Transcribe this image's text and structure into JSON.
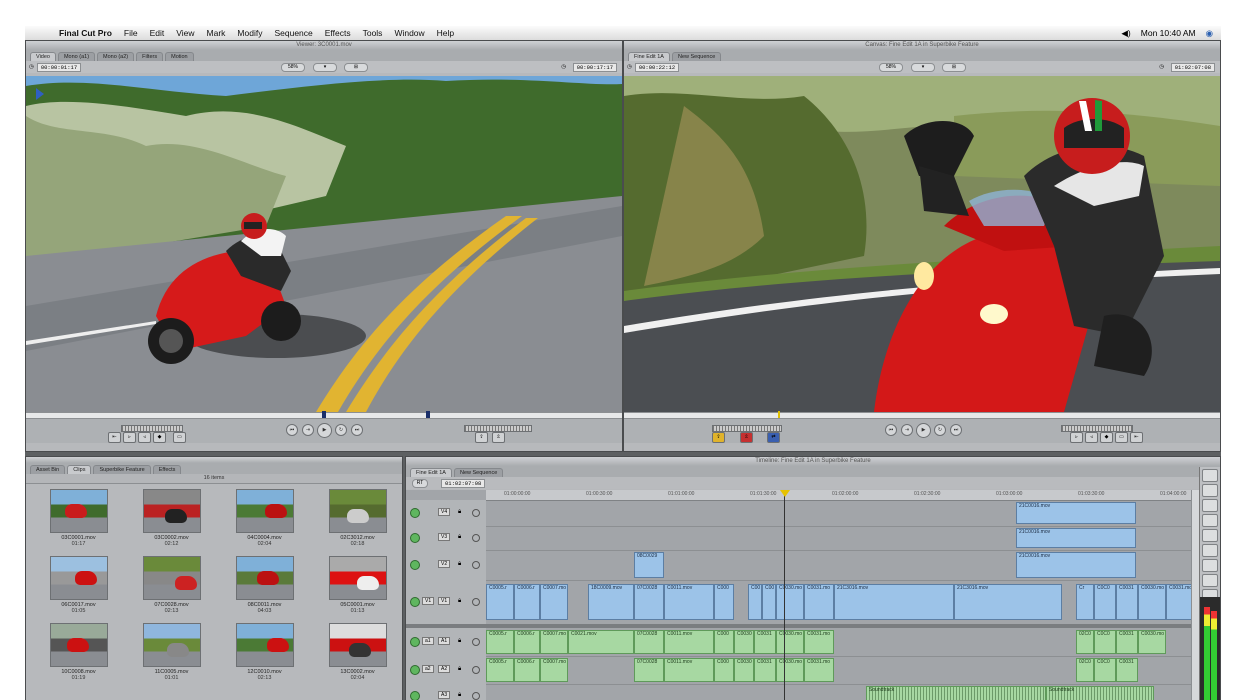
{
  "menubar": {
    "apple_glyph": "",
    "app_name": "Final Cut Pro",
    "items": [
      "File",
      "Edit",
      "View",
      "Mark",
      "Modify",
      "Sequence",
      "Effects",
      "Tools",
      "Window",
      "Help"
    ],
    "clock": "Mon 10:40 AM",
    "volume_glyph": "◀)",
    "spotlight_glyph": "◉"
  },
  "viewer": {
    "title": "Viewer: 3C0001.mov",
    "tabs": [
      "Video",
      "Mono (a1)",
      "Mono (a2)",
      "Filters",
      "Motion"
    ],
    "duration_timecode": "00:00:01:17",
    "current_timecode": "00:00:17:17",
    "zoom_label": "58%",
    "view_label": "▾",
    "overlay_label": "⊞"
  },
  "canvas": {
    "title": "Canvas: Fine Edit 1A in Superbike Feature",
    "tabs": [
      "Fine Edit 1A",
      "New Sequence"
    ],
    "duration_timecode": "00:00:22:12",
    "current_timecode": "01:02:07:08",
    "zoom_label": "58%",
    "view_label": "▾",
    "overlay_label": "⊞"
  },
  "browser": {
    "tabs": [
      "Asset Bin",
      "Clips",
      "Superbike Feature",
      "Effects"
    ],
    "item_count": "16 items",
    "clips": [
      {
        "name": "03C0001.mov",
        "duration": "01:17"
      },
      {
        "name": "03C0002.mov",
        "duration": "02:12"
      },
      {
        "name": "04C0004.mov",
        "duration": "02:04"
      },
      {
        "name": "02C3012.mov",
        "duration": "02:18"
      },
      {
        "name": "06C0017.mov",
        "duration": "01:05"
      },
      {
        "name": "07C0028.mov",
        "duration": "02:13"
      },
      {
        "name": "08C0011.mov",
        "duration": "04:03"
      },
      {
        "name": "05C0001.mov",
        "duration": "01:13"
      },
      {
        "name": "10C0008.mov",
        "duration": "01:19"
      },
      {
        "name": "11C0005.mov",
        "duration": "01:01"
      },
      {
        "name": "12C0010.mov",
        "duration": "02:13"
      },
      {
        "name": "13C0002.mov",
        "duration": "02:04"
      }
    ]
  },
  "timeline": {
    "title": "Timeline: Fine Edit 1A in Superbike Feature",
    "tabs": [
      "Fine Edit 1A",
      "New Sequence"
    ],
    "current_timecode": "01:02:07:08",
    "ruler_ticks": [
      "01:00:00:00",
      "01:00:30:00",
      "01:01:00:00",
      "01:01:30:00",
      "01:02:00:00",
      "01:02:30:00",
      "01:03:00:00",
      "01:03:30:00",
      "01:04:00:00"
    ],
    "video_tracks": [
      {
        "label": "V4",
        "clips": [
          {
            "name": "21C0016.mov"
          }
        ]
      },
      {
        "label": "V3",
        "clips": [
          {
            "name": "21C0016.mov"
          }
        ]
      },
      {
        "label": "V2",
        "clips": [
          {
            "name": "08C0029"
          },
          {
            "name": "21C0016.mov"
          }
        ]
      },
      {
        "label": "V1",
        "source": "V1",
        "clips": [
          {
            "name": "C0005.r"
          },
          {
            "name": "C0006.r"
          },
          {
            "name": "C0007.mo"
          },
          {
            "name": "18C0009.mov"
          },
          {
            "name": "07C0028"
          },
          {
            "name": "C0011.mov"
          },
          {
            "name": "C000"
          },
          {
            "name": "C00"
          },
          {
            "name": "C00"
          },
          {
            "name": "C0030.mo"
          },
          {
            "name": "C0031.mo"
          },
          {
            "name": "21C3016.mov"
          },
          {
            "name": "21C3016.mov"
          },
          {
            "name": "Cr"
          },
          {
            "name": "C0C0"
          },
          {
            "name": "C0031"
          },
          {
            "name": "C0030.mo"
          },
          {
            "name": "C0031.mo"
          }
        ]
      }
    ],
    "audio_tracks": [
      {
        "label": "A1",
        "source": "a1",
        "clips": [
          {
            "name": "C0005.r"
          },
          {
            "name": "C0006.r"
          },
          {
            "name": "C0007.mo"
          },
          {
            "name": "C0021.mov"
          },
          {
            "name": "07C0028"
          },
          {
            "name": "C0011.mov"
          },
          {
            "name": "C000"
          },
          {
            "name": "C0030"
          },
          {
            "name": "C0031"
          },
          {
            "name": "C0030.mo"
          },
          {
            "name": "C0031.mo"
          },
          {
            "name": "02C0"
          },
          {
            "name": "C0C0"
          },
          {
            "name": "C0031"
          },
          {
            "name": "C0030.mo"
          }
        ]
      },
      {
        "label": "A2",
        "source": "a2",
        "clips": [
          {
            "name": "C0005.r"
          },
          {
            "name": "C0006.r"
          },
          {
            "name": "C0007.mo"
          },
          {
            "name": "07C0028"
          },
          {
            "name": "C0011.mov"
          },
          {
            "name": "C000"
          },
          {
            "name": "C0030"
          },
          {
            "name": "C0031"
          },
          {
            "name": "C0030.mo"
          },
          {
            "name": "C0031.mo"
          },
          {
            "name": "02C0"
          },
          {
            "name": "C0C0"
          },
          {
            "name": "C0031"
          }
        ]
      },
      {
        "label": "A3",
        "clips": [
          {
            "name": "Soundtrack"
          },
          {
            "name": "Soundtrack"
          }
        ]
      }
    ]
  }
}
